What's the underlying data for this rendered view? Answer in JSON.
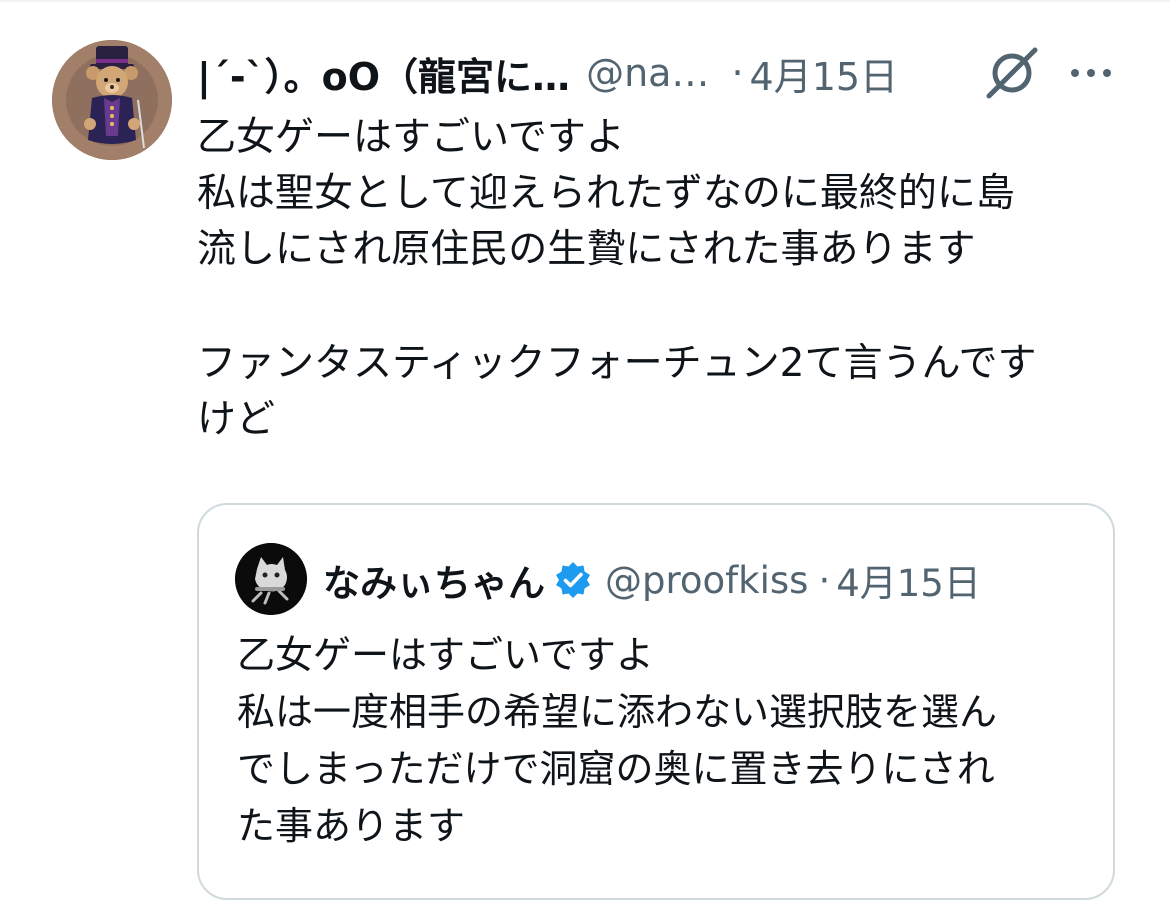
{
  "tweet": {
    "author_name": "|´-`）。oO（龍宮に…",
    "author_handle": "@na…",
    "separator": "·",
    "date": "4月15日",
    "avatar_icon": "teddy-bear-avatar-icon",
    "text_lines": [
      "乙女ゲーはすごいですよ",
      "私は聖女として迎えられたずなのに最終的に島",
      "流しにされ原住民の生贄にされた事あります",
      "",
      "ファンタスティックフォーチュン2て言うんです",
      "けど"
    ]
  },
  "quoted_tweet": {
    "author_name": "なみぃちゃん",
    "verified": true,
    "author_handle": "@proofkiss",
    "separator": "·",
    "date": "4月15日",
    "text_lines": [
      "乙女ゲーはすごいですよ",
      "私は一度相手の希望に添わない選択肢を選ん",
      "でしまっただけで洞窟の奥に置き去りにされ",
      "た事あります"
    ]
  },
  "colors": {
    "text_primary": "#0f1419",
    "text_secondary": "#536471",
    "border": "#cfd9de",
    "verified_blue": "#1d9bf0"
  }
}
